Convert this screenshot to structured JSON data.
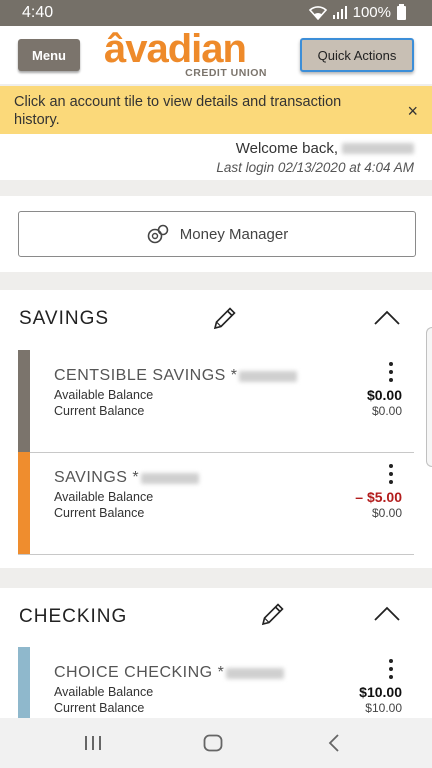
{
  "status_bar": {
    "time": "4:40",
    "battery": "100%"
  },
  "header": {
    "menu_label": "Menu",
    "logo_text": "âvadian",
    "logo_subtext": "CREDIT UNION",
    "quick_actions_label": "Quick Actions"
  },
  "banner": {
    "message": "Click an account tile to view details and transaction history.",
    "close_symbol": "×"
  },
  "welcome": {
    "greeting": "Welcome back,",
    "last_login": "Last login 02/13/2020 at 4:04 AM"
  },
  "money_manager": {
    "label": "Money Manager"
  },
  "labels": {
    "available": "Available Balance",
    "current": "Current Balance"
  },
  "savings": {
    "title": "SAVINGS",
    "accounts": [
      {
        "name": "CENTSIBLE SAVINGS *",
        "available": "$0.00",
        "current": "$0.00",
        "color": "#7b746c"
      },
      {
        "name": "SAVINGS *",
        "available": "– $5.00",
        "current": "$0.00",
        "color": "#ef8d2e"
      }
    ]
  },
  "checking": {
    "title": "CHECKING",
    "accounts": [
      {
        "name": "CHOICE CHECKING *",
        "available": "$10.00",
        "current": "$10.00",
        "color": "#8fb8cc"
      }
    ]
  },
  "colors": {
    "brand_orange": "#ee8a2a",
    "brand_gray": "#7b746c",
    "banner_yellow": "#fbd97a",
    "negative_red": "#b31d1d"
  }
}
